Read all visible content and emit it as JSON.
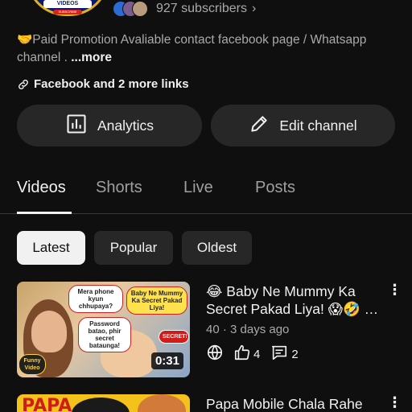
{
  "channel": {
    "logo_text": "VIDEOS",
    "logo_badge": "SUBSCRIBE",
    "subscribers": "927 subscribers",
    "description": "🤝Paid Promotion Avaliable contact facebook page / Whatsapp channel . ",
    "more_label": "...more",
    "links_label": "Facebook and 2 more links"
  },
  "actions": {
    "analytics_label": "Analytics",
    "edit_label": "Edit channel"
  },
  "tabs": [
    {
      "label": "Videos",
      "active": true
    },
    {
      "label": "Shorts",
      "active": false
    },
    {
      "label": "Live",
      "active": false
    },
    {
      "label": "Posts",
      "active": false
    }
  ],
  "chips": [
    {
      "label": "Latest",
      "active": true
    },
    {
      "label": "Popular",
      "active": false
    },
    {
      "label": "Oldest",
      "active": false
    }
  ],
  "videos": [
    {
      "title": "😂 Baby Ne Mummy Ka Secret Pakad Liya! 😱🤣 …",
      "meta": "40 · 3 days ago",
      "likes": "4",
      "comments": "2",
      "duration": "0:31",
      "thumb_text": {
        "bubble1": "Mera phone kyun chhupaya?",
        "bubble2": "Baby Ne Mummy Ka Secret Pakad Liya!",
        "bubble3": "Password batao, phir secret bataunga!",
        "badge": "SECRET!",
        "corner": "Funny Video"
      }
    },
    {
      "title": "Papa Mobile Chala Rahe",
      "thumb_text": {
        "headline": "PAPA"
      }
    }
  ],
  "colors": {
    "background": "#0f0f0f",
    "surface": "#272727",
    "text_primary": "#f1f1f1",
    "text_secondary": "#aaaaaa"
  }
}
